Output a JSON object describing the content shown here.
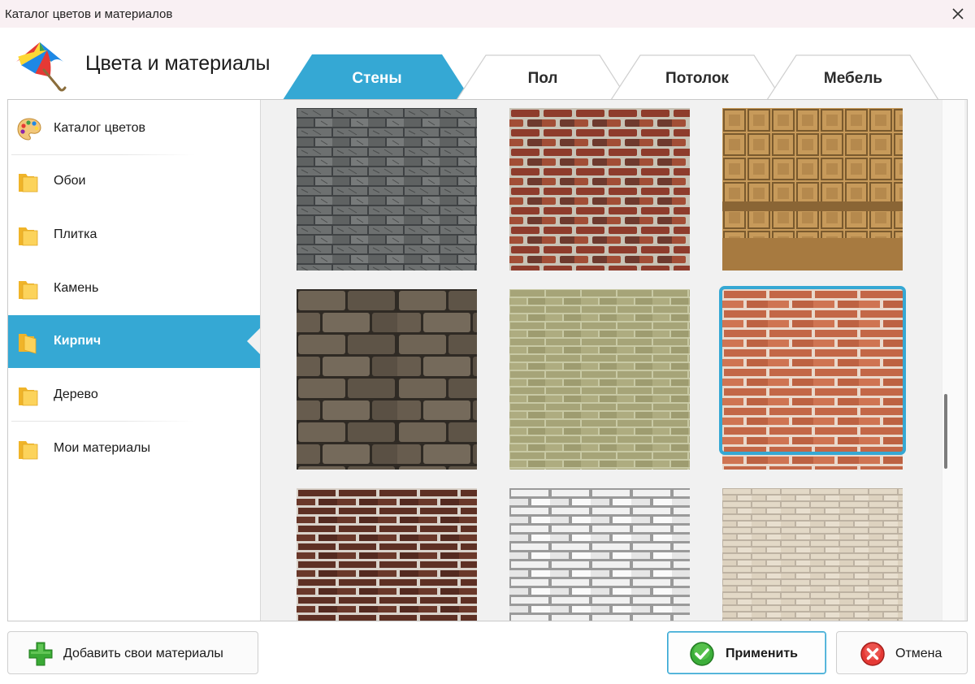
{
  "window": {
    "title": "Каталог цветов и материалов"
  },
  "header": {
    "title": "Цвета и материалы"
  },
  "tabs": [
    {
      "label": "Стены",
      "active": true
    },
    {
      "label": "Пол",
      "active": false
    },
    {
      "label": "Потолок",
      "active": false
    },
    {
      "label": "Мебель",
      "active": false
    }
  ],
  "sidebar": {
    "items": [
      {
        "label": "Каталог цветов",
        "icon": "palette-icon"
      },
      {
        "label": "Обои",
        "icon": "folder-icon"
      },
      {
        "label": "Плитка",
        "icon": "folder-icon"
      },
      {
        "label": "Камень",
        "icon": "folder-icon"
      },
      {
        "label": "Кирпич",
        "icon": "folder-open-icon",
        "active": true
      },
      {
        "label": "Дерево",
        "icon": "folder-icon"
      },
      {
        "label": "Мои материалы",
        "icon": "folder-icon"
      }
    ]
  },
  "materials": {
    "selected_index": 5,
    "items": [
      {
        "name": "gray-stone-brick"
      },
      {
        "name": "old-red-brick"
      },
      {
        "name": "ornamental-sandstone-brick"
      },
      {
        "name": "brown-stone-brick"
      },
      {
        "name": "olive-brick"
      },
      {
        "name": "red-brick"
      },
      {
        "name": "dark-brown-brick"
      },
      {
        "name": "white-brick"
      },
      {
        "name": "beige-brick"
      }
    ]
  },
  "buttons": {
    "add": "Добавить свои материалы",
    "apply": "Применить",
    "cancel": "Отмена"
  },
  "colors": {
    "accent": "#35a8d4",
    "tab_inactive": "#ffffff",
    "content_bg": "#f1f1f1"
  }
}
